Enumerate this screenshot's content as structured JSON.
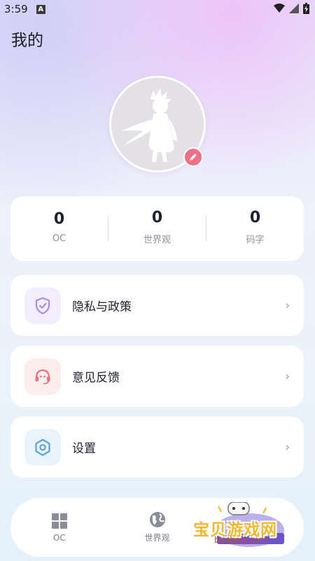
{
  "status_bar": {
    "time": "3:59",
    "notification_letter": "A"
  },
  "page": {
    "title": "我的"
  },
  "stats": [
    {
      "value": "0",
      "label": "OC"
    },
    {
      "value": "0",
      "label": "世界观"
    },
    {
      "value": "0",
      "label": "码字"
    }
  ],
  "menu": [
    {
      "label": "隐私与政策",
      "icon": "shield-check-icon",
      "chevron": "›"
    },
    {
      "label": "意见反馈",
      "icon": "headset-icon",
      "chevron": "›"
    },
    {
      "label": "设置",
      "icon": "settings-hexagon-icon",
      "chevron": "›"
    }
  ],
  "bottom_nav": [
    {
      "label": "OC",
      "icon": "grid-icon"
    },
    {
      "label": "世界观",
      "icon": "globe-icon"
    }
  ],
  "watermark": {
    "text": "宝贝游戏网",
    "url": "baobeiy.com"
  },
  "colors": {
    "edit_badge": "#ee6f86",
    "privacy_icon": "#a98ee6",
    "feedback_icon": "#ee6f76",
    "settings_icon": "#5aa6dc"
  }
}
